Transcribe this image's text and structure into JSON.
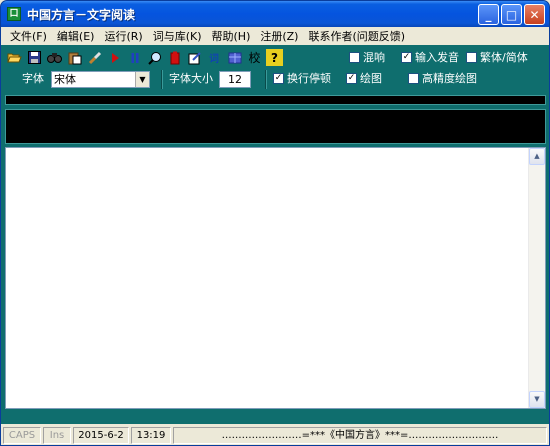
{
  "window": {
    "title": "中国方言－文字阅读"
  },
  "menu": [
    "文件(F)",
    "编辑(E)",
    "运行(R)",
    "词与库(K)",
    "帮助(H)",
    "注册(Z)",
    "联系作者(问题反馈)"
  ],
  "toolbar": {
    "buttons": [
      "open-icon",
      "save-icon",
      "find-icon",
      "paste-icon",
      "brush-icon",
      "play-icon",
      "pause-icon",
      "zoom-icon",
      "stop-icon",
      "edit-icon",
      "lexicon-icon",
      "table-icon",
      "proof-icon",
      "help-icon"
    ],
    "proof_label": "校",
    "help_label": "?"
  },
  "options": {
    "mute": {
      "label": "混响",
      "checked": false
    },
    "input_voice": {
      "label": "输入发音",
      "checked": true
    },
    "trad_simp": {
      "label": "繁体/简体",
      "checked": false
    },
    "line_pause": {
      "label": "换行停顿",
      "checked": true
    },
    "draw": {
      "label": "绘图",
      "checked": true
    },
    "hi_precision_draw": {
      "label": "高精度绘图",
      "checked": false
    }
  },
  "font": {
    "label": "字体",
    "value": "宋体",
    "size_label": "字体大小",
    "size_value": "12"
  },
  "status": {
    "caps": "CAPS",
    "ins": "Ins",
    "date": "2015-6-2",
    "time": "13:19",
    "message": "……………………=***《中国方言》***=………………………"
  },
  "colors": {
    "window_bg": "#0f6e6e",
    "titlebar": "#0554df",
    "display_bar": "#000000"
  }
}
